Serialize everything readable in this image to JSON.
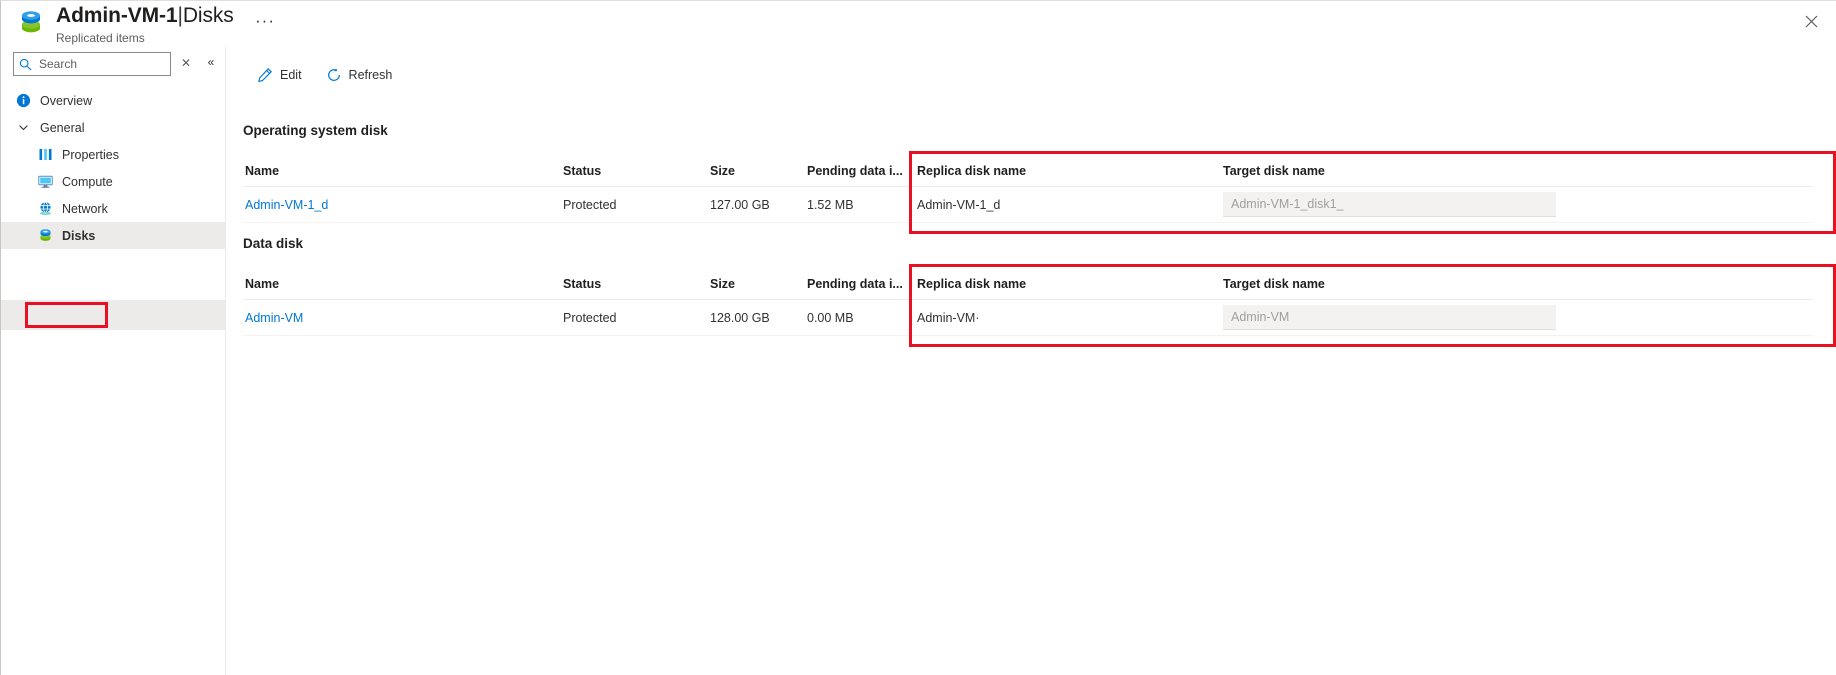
{
  "header": {
    "title_resource": "Admin-VM-1",
    "title_separator": "|",
    "title_page": "Disks",
    "subtitle": "Replicated items",
    "ellipsis": "···",
    "close_label": "✕",
    "icon": "replicated-disk-icon"
  },
  "sidebar": {
    "search": {
      "placeholder": "Search",
      "value": "",
      "icon": "search-icon",
      "dismiss_label": "✕",
      "collapse_label": "«"
    },
    "items": [
      {
        "label": "Overview",
        "icon": "info-icon",
        "level": "top",
        "selected": false
      },
      {
        "label": "General",
        "icon": "chevron-down-icon",
        "level": "group",
        "selected": false
      },
      {
        "label": "Properties",
        "icon": "properties-icon",
        "level": "child",
        "selected": false
      },
      {
        "label": "Compute",
        "icon": "compute-icon",
        "level": "child",
        "selected": false
      },
      {
        "label": "Network",
        "icon": "network-icon",
        "level": "child",
        "selected": false
      },
      {
        "label": "Disks",
        "icon": "disks-icon",
        "level": "child",
        "selected": true
      }
    ]
  },
  "toolbar": {
    "edit_label": "Edit",
    "edit_icon": "pencil-icon",
    "refresh_label": "Refresh",
    "refresh_icon": "refresh-icon"
  },
  "sections": {
    "os": {
      "title": "Operating system disk",
      "columns": {
        "name": "Name",
        "status": "Status",
        "size": "Size",
        "pending": "Pending data i...",
        "replica": "Replica disk name",
        "target": "Target disk name"
      },
      "row": {
        "name": "Admin-VM-1_d",
        "status": "Protected",
        "size": "127.00 GB",
        "pending": "1.52 MB",
        "replica": "Admin-VM-1_d",
        "target_placeholder": "Admin-VM-1_disk1_",
        "target_value": ""
      }
    },
    "data": {
      "title": "Data disk",
      "columns": {
        "name": "Name",
        "status": "Status",
        "size": "Size",
        "pending": "Pending data i...",
        "replica": "Replica disk name",
        "target": "Target disk name"
      },
      "row": {
        "name": "Admin-VM",
        "status": "Protected",
        "size": "128.00 GB",
        "pending": "0.00 MB",
        "replica": "Admin-VM·",
        "target_placeholder": "Admin-VM",
        "target_value": ""
      }
    }
  },
  "annotations": {
    "highlight_color": "#e81123",
    "boxes": [
      {
        "name": "sidebar-disks-highlight"
      },
      {
        "name": "os-disk-replica-target-highlight"
      },
      {
        "name": "data-disk-replica-target-highlight"
      }
    ]
  }
}
